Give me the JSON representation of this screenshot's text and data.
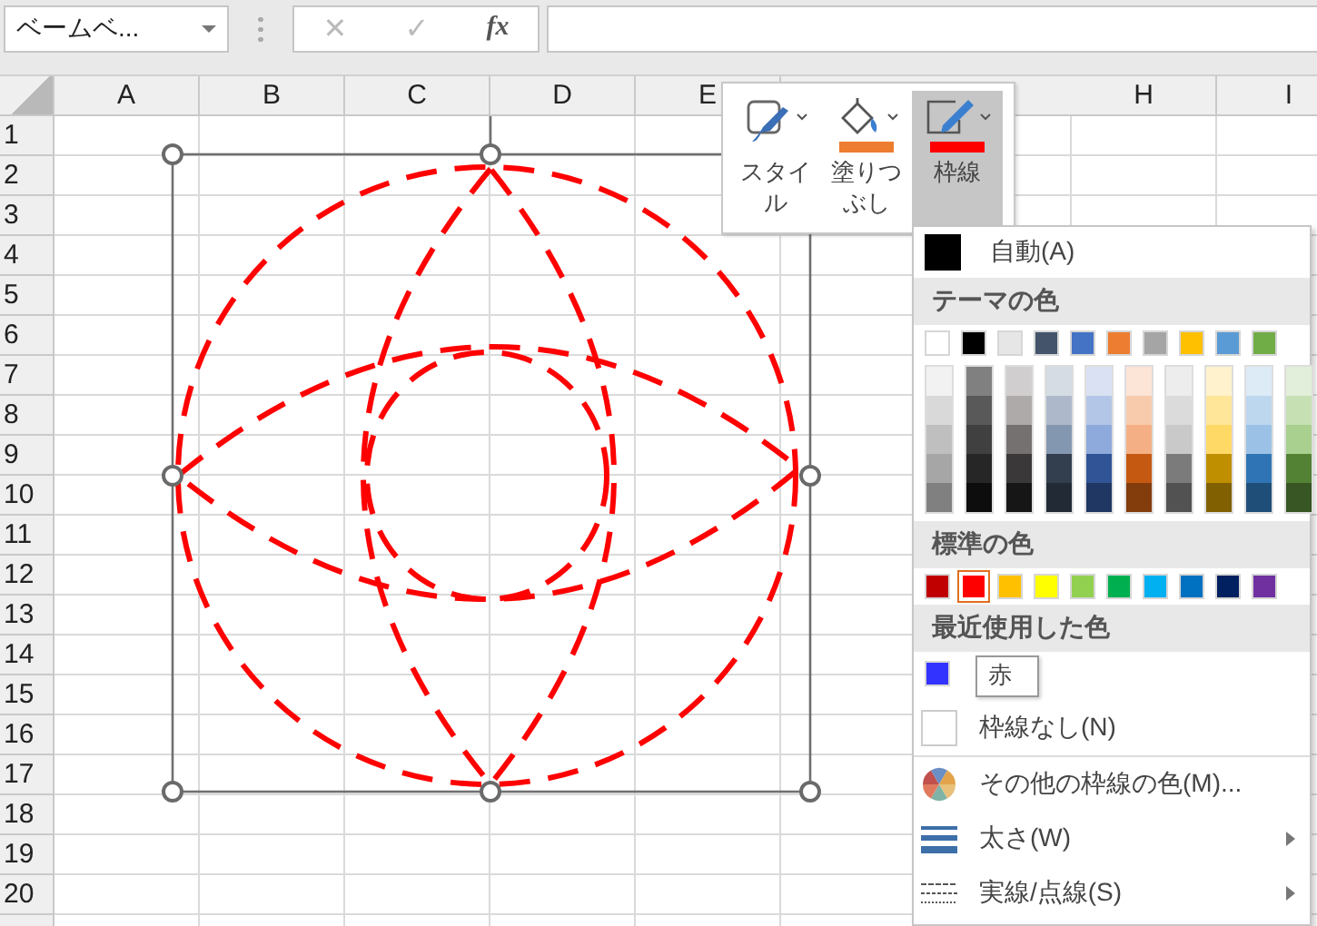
{
  "name_box": {
    "value": "ベームベ..."
  },
  "formula_buttons": [
    {
      "label": "✕",
      "disabled": true
    },
    {
      "label": "✓",
      "disabled": true
    },
    {
      "label": "fx",
      "disabled": false
    }
  ],
  "columns_left": [
    "A",
    "B",
    "C",
    "D",
    "E"
  ],
  "columns_right": [
    "H",
    "I"
  ],
  "rows": [
    "1",
    "2",
    "3",
    "4",
    "5",
    "6",
    "7",
    "8",
    "9",
    "10",
    "11",
    "12",
    "13",
    "14",
    "15",
    "16",
    "17",
    "18",
    "19",
    "20"
  ],
  "shape": {
    "kind": "dashed-circles",
    "selected": true
  },
  "mini_toolbar": {
    "buttons": [
      {
        "kind": "style",
        "label": "スタイル",
        "selected": false
      },
      {
        "kind": "fill",
        "label": "塗りつぶし",
        "selected": false,
        "color": "#ed7d31"
      },
      {
        "kind": "border",
        "label": "枠線",
        "selected": true,
        "color": "#ff0000"
      }
    ]
  },
  "border_menu": {
    "automatic": {
      "label": "自動(A)",
      "color": "#000000"
    },
    "theme_header": "テーマの色",
    "theme_colors": [
      {
        "color": "#ffffff",
        "shades": [
          {
            "color": "#f2f2f2"
          },
          {
            "color": "#d9d9d9"
          },
          {
            "color": "#bfbfbf"
          },
          {
            "color": "#a6a6a6"
          },
          {
            "color": "#808080"
          }
        ]
      },
      {
        "color": "#000000",
        "shades": [
          {
            "color": "#808080"
          },
          {
            "color": "#595959"
          },
          {
            "color": "#404040"
          },
          {
            "color": "#262626"
          },
          {
            "color": "#0d0d0d"
          }
        ]
      },
      {
        "color": "#e7e6e6",
        "shades": [
          {
            "color": "#d0cece"
          },
          {
            "color": "#aeaaaa"
          },
          {
            "color": "#757171"
          },
          {
            "color": "#3a3838"
          },
          {
            "color": "#171616"
          }
        ]
      },
      {
        "color": "#44546a",
        "shades": [
          {
            "color": "#d6dce4"
          },
          {
            "color": "#adb9ca"
          },
          {
            "color": "#8497b0"
          },
          {
            "color": "#333f4f"
          },
          {
            "color": "#222b35"
          }
        ]
      },
      {
        "color": "#4472c4",
        "shades": [
          {
            "color": "#d9e1f2"
          },
          {
            "color": "#b4c6e7"
          },
          {
            "color": "#8ea9db"
          },
          {
            "color": "#305496"
          },
          {
            "color": "#203764"
          }
        ]
      },
      {
        "color": "#ed7d31",
        "shades": [
          {
            "color": "#fce4d6"
          },
          {
            "color": "#f8cbad"
          },
          {
            "color": "#f4b084"
          },
          {
            "color": "#c65911"
          },
          {
            "color": "#833c0c"
          }
        ]
      },
      {
        "color": "#a5a5a5",
        "shades": [
          {
            "color": "#ededed"
          },
          {
            "color": "#dbdbdb"
          },
          {
            "color": "#c9c9c9"
          },
          {
            "color": "#7b7b7b"
          },
          {
            "color": "#525252"
          }
        ]
      },
      {
        "color": "#ffc000",
        "shades": [
          {
            "color": "#fff2cc"
          },
          {
            "color": "#ffe699"
          },
          {
            "color": "#ffd966"
          },
          {
            "color": "#bf8f00"
          },
          {
            "color": "#806000"
          }
        ]
      },
      {
        "color": "#5b9bd5",
        "shades": [
          {
            "color": "#ddebf7"
          },
          {
            "color": "#bdd7ee"
          },
          {
            "color": "#9bc2e6"
          },
          {
            "color": "#2f75b5"
          },
          {
            "color": "#1f4e78"
          }
        ]
      },
      {
        "color": "#70ad47",
        "shades": [
          {
            "color": "#e2efda"
          },
          {
            "color": "#c6e0b4"
          },
          {
            "color": "#a9d08e"
          },
          {
            "color": "#548235"
          },
          {
            "color": "#375623"
          }
        ]
      }
    ],
    "standard_header": "標準の色",
    "standard_colors": [
      {
        "color": "#c00000",
        "selected": false
      },
      {
        "color": "#ff0000",
        "selected": true
      },
      {
        "color": "#ffc000",
        "selected": false
      },
      {
        "color": "#ffff00",
        "selected": false
      },
      {
        "color": "#92d050",
        "selected": false
      },
      {
        "color": "#00b050",
        "selected": false
      },
      {
        "color": "#00b0f0",
        "selected": false
      },
      {
        "color": "#0070c0",
        "selected": false
      },
      {
        "color": "#002060",
        "selected": false
      },
      {
        "color": "#7030a0",
        "selected": false
      }
    ],
    "recent_header": "最近使用した色",
    "recent_colors": [
      {
        "color": "#3333ff"
      }
    ],
    "items": [
      {
        "kind": "none",
        "label": "枠線なし(N)",
        "submenu": false
      },
      {
        "kind": "more",
        "label": "その他の枠線の色(M)...",
        "submenu": false
      },
      {
        "kind": "weight",
        "label": "太さ(W)",
        "submenu": true
      },
      {
        "kind": "dashes",
        "label": "実線/点線(S)",
        "submenu": true
      }
    ]
  },
  "tooltip": {
    "text": "赤"
  }
}
